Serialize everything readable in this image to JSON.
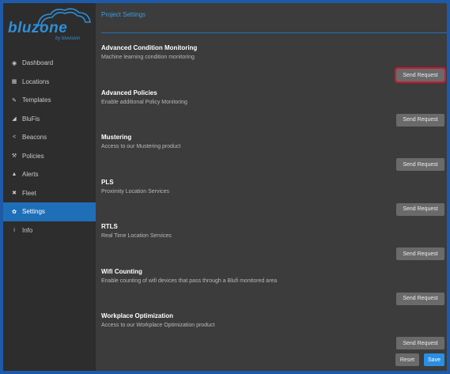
{
  "brand": {
    "name": "bluzone",
    "tagline": "by bluvision"
  },
  "nav": [
    {
      "label": "Dashboard",
      "icon": "dashboard-icon",
      "glyph": "◉"
    },
    {
      "label": "Locations",
      "icon": "locations-icon",
      "glyph": "▦"
    },
    {
      "label": "Templates",
      "icon": "templates-icon",
      "glyph": "✎"
    },
    {
      "label": "BluFis",
      "icon": "blufis-icon",
      "glyph": "◢"
    },
    {
      "label": "Beacons",
      "icon": "beacons-icon",
      "glyph": "<"
    },
    {
      "label": "Policies",
      "icon": "policies-icon",
      "glyph": "⚒"
    },
    {
      "label": "Alerts",
      "icon": "alerts-icon",
      "glyph": "▲"
    },
    {
      "label": "Fleet",
      "icon": "fleet-icon",
      "glyph": "✖"
    },
    {
      "label": "Settings",
      "icon": "settings-icon",
      "glyph": "✿",
      "active": true
    },
    {
      "label": "Info",
      "icon": "info-icon",
      "glyph": "i"
    }
  ],
  "page_title": "Project Settings",
  "send_label": "Send Request",
  "sections": [
    {
      "title": "Advanced Condition Monitoring",
      "desc": "Machine learning condition monitoring",
      "highlight": true
    },
    {
      "title": "Advanced Policies",
      "desc": "Enable additional Policy Monitoring"
    },
    {
      "title": "Mustering",
      "desc": "Access to our Mustering product"
    },
    {
      "title": "PLS",
      "desc": "Proximity Location Services"
    },
    {
      "title": "RTLS",
      "desc": "Real Time Location Services"
    },
    {
      "title": "Wifi Counting",
      "desc": "Enable counting of wifi devices that pass through a Blufi monitored area"
    },
    {
      "title": "Workplace Optimization",
      "desc": "Access to our Workplace Optimization product"
    }
  ],
  "footer": {
    "reset_label": "Reset",
    "save_label": "Save"
  }
}
